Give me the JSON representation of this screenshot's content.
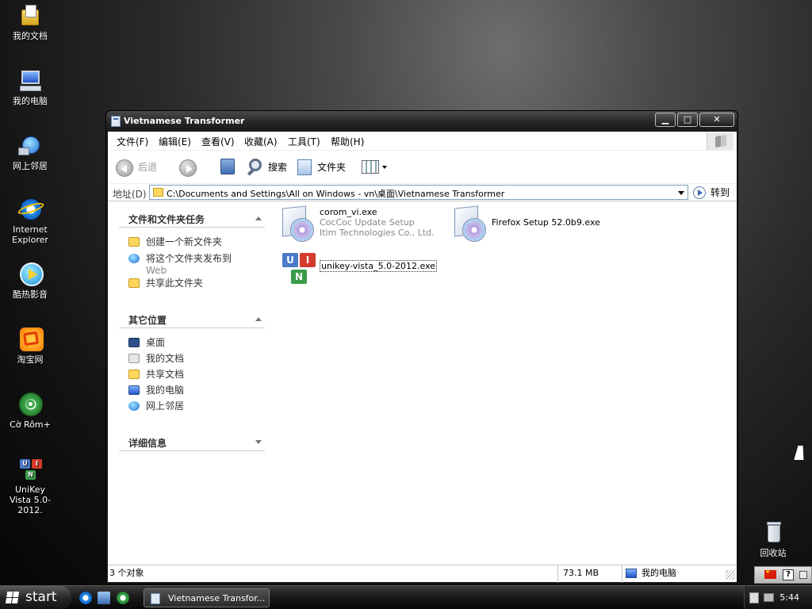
{
  "desktop": {
    "icons": [
      {
        "label": "我的文档"
      },
      {
        "label": "我的电脑"
      },
      {
        "label": "网上邻居"
      },
      {
        "label": "Internet Explorer"
      },
      {
        "label": "酷热影音"
      },
      {
        "label": "淘宝网"
      },
      {
        "label": "Cờ Rôm+"
      },
      {
        "label": "UniKey Vista 5.0-2012."
      },
      {
        "label": "回收站"
      }
    ],
    "colors": {
      "background": "#2a2a2a",
      "text": "#ffffff"
    }
  },
  "window": {
    "title": "Vietnamese Transformer",
    "menu": [
      "文件(F)",
      "编辑(E)",
      "查看(V)",
      "收藏(A)",
      "工具(T)",
      "帮助(H)"
    ],
    "toolbar": {
      "back": "后退",
      "search": "搜索",
      "folders": "文件夹"
    },
    "address": {
      "label": "地址(D)",
      "value": "C:\\Documents and Settings\\All on Windows - vn\\桌面\\Vietnamese Transformer",
      "go": "转到"
    },
    "taskpane": {
      "file_tasks": {
        "title": "文件和文件夹任务",
        "items": [
          "创建一个新文件夹",
          "将这个文件夹发布到",
          "Web",
          "共享此文件夹"
        ]
      },
      "other_places": {
        "title": "其它位置",
        "items": [
          "桌面",
          "我的文档",
          "共享文档",
          "我的电脑",
          "网上邻居"
        ]
      },
      "details": {
        "title": "详细信息"
      }
    },
    "files": [
      {
        "name": "corom_vi.exe",
        "line2": "CocCoc Update Setup",
        "line3": "Itim Technologies Co., Ltd."
      },
      {
        "name": "Firefox Setup 52.0b9.exe"
      },
      {
        "name": "unikey-vista_5.0-2012.exe"
      }
    ],
    "status": {
      "count": "3 个对象",
      "size": "73.1 MB",
      "location": "我的电脑"
    }
  },
  "taskbar": {
    "start": "start",
    "task_button": "Vietnamese Transfor...",
    "clock": "5:44",
    "tray_help": "?"
  },
  "icons": {
    "window_icon": "folder-window-icon",
    "back": "back-arrow-icon",
    "forward": "forward-arrow-icon",
    "up": "up-folder-icon",
    "search": "search-icon",
    "folders": "folders-icon",
    "views": "views-icon",
    "go": "go-arrow-icon"
  }
}
